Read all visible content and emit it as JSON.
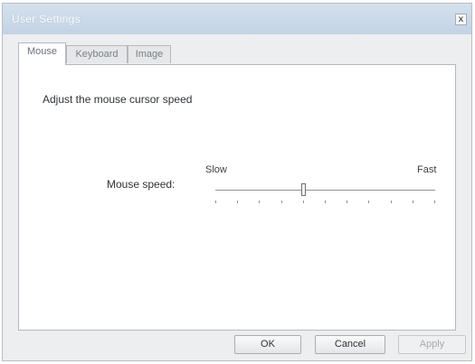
{
  "window": {
    "title": "User Settings",
    "close_glyph": "x"
  },
  "tabs": [
    {
      "label": "Mouse",
      "active": true
    },
    {
      "label": "Keyboard",
      "active": false
    },
    {
      "label": "Image",
      "active": false
    }
  ],
  "mouse_panel": {
    "heading": "Adjust the mouse cursor speed",
    "speed_label": "Mouse speed:",
    "slow_label": "Slow",
    "fast_label": "Fast",
    "speed_level": 0.4,
    "tick_count": 11
  },
  "buttons": {
    "ok": "OK",
    "cancel": "Cancel",
    "apply": "Apply",
    "apply_enabled": false
  }
}
